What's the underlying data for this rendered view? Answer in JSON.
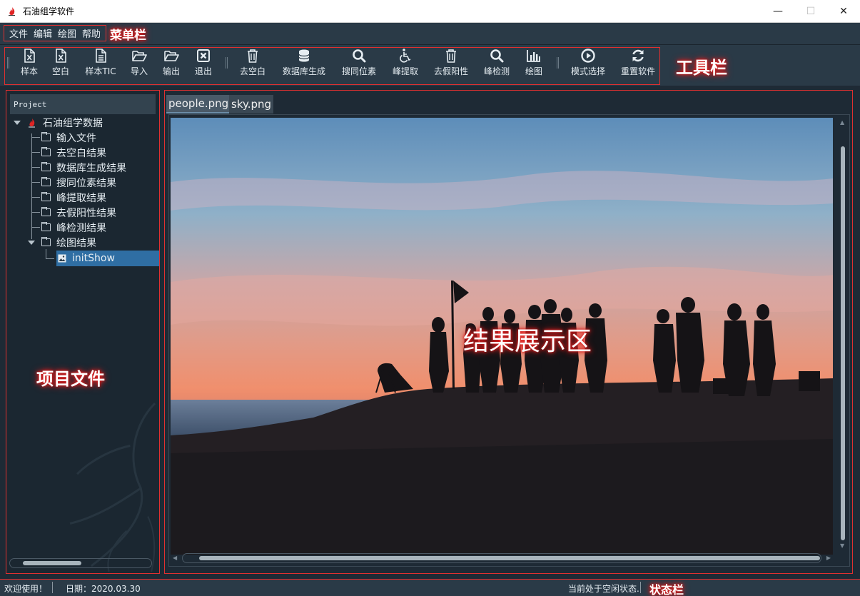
{
  "window": {
    "title": "石油组学软件",
    "minimize": "—",
    "maximize": "☐",
    "close": "✕"
  },
  "menubar": {
    "items": [
      "文件",
      "编辑",
      "绘图",
      "帮助"
    ],
    "callout": "菜单栏"
  },
  "toolbar": {
    "callout": "工具栏",
    "buttons": [
      {
        "label": "样本",
        "icon": "excel-file-icon"
      },
      {
        "label": "空白",
        "icon": "excel-file-icon"
      },
      {
        "label": "样本TIC",
        "icon": "document-icon"
      },
      {
        "label": "导入",
        "icon": "folder-open-icon"
      },
      {
        "label": "输出",
        "icon": "folder-open-icon"
      },
      {
        "label": "退出",
        "icon": "close-box-icon"
      },
      {
        "label": "去空白",
        "icon": "trash-icon"
      },
      {
        "label": "数据库生成",
        "icon": "database-icon"
      },
      {
        "label": "搜同位素",
        "icon": "search-icon"
      },
      {
        "label": "峰提取",
        "icon": "wheelchair-icon"
      },
      {
        "label": "去假阳性",
        "icon": "trash-icon"
      },
      {
        "label": "峰检测",
        "icon": "search-icon"
      },
      {
        "label": "绘图",
        "icon": "bar-chart-icon"
      },
      {
        "label": "模式选择",
        "icon": "play-circle-icon"
      },
      {
        "label": "重置软件",
        "icon": "refresh-icon"
      }
    ]
  },
  "project": {
    "header": "Project",
    "callout": "项目文件",
    "root": "石油组学数据",
    "folders": [
      "输入文件",
      "去空白结果",
      "数据库生成结果",
      "搜同位素结果",
      "峰提取结果",
      "去假阳性结果",
      "峰检测结果",
      "绘图结果"
    ],
    "selected_file": "initShow"
  },
  "main": {
    "tabs": [
      "people.png",
      "sky.png"
    ],
    "active_tab": 0,
    "callout": "结果展示区"
  },
  "statusbar": {
    "welcome": "欢迎使用！",
    "date": "日期：2020.03.30",
    "state": "当前处于空闲状态.",
    "callout": "状态栏"
  },
  "colors": {
    "accent_border": "#e03030",
    "selection": "#2f6ea3",
    "background": "#1e2a35"
  }
}
